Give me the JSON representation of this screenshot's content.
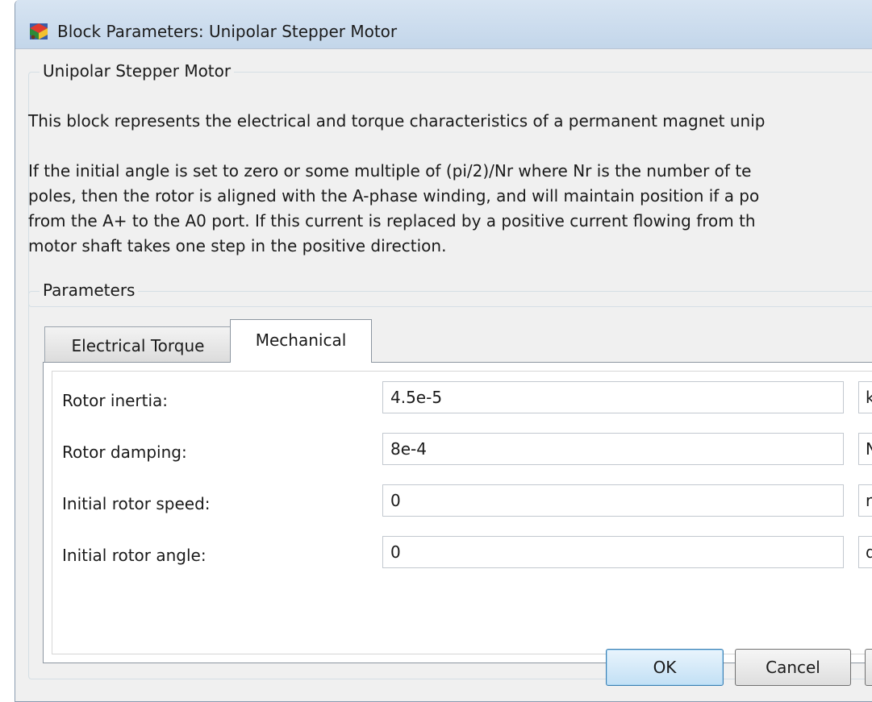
{
  "window": {
    "title": "Block Parameters: Unipolar Stepper Motor"
  },
  "description": {
    "group_title": "Unipolar Stepper Motor",
    "paragraph1": "This block represents the electrical and torque characteristics of a permanent magnet unip",
    "paragraph2_lines": [
      "If the initial angle is set to zero or some multiple of (pi/2)/Nr where Nr is the number of te",
      "poles, then the rotor is aligned with the A-phase winding, and will maintain position if a po",
      "from the A+ to the A0 port. If this current is replaced by a positive current flowing from th",
      "motor shaft takes one step in the positive direction."
    ]
  },
  "parameters": {
    "group_title": "Parameters",
    "tabs": [
      {
        "label": "Electrical Torque",
        "active": false
      },
      {
        "label": "Mechanical",
        "active": true
      }
    ],
    "fields": [
      {
        "label": "Rotor inertia:",
        "value": "4.5e-5",
        "unit": "k"
      },
      {
        "label": "Rotor damping:",
        "value": "8e-4",
        "unit": "N"
      },
      {
        "label": "Initial rotor speed:",
        "value": "0",
        "unit": "r"
      },
      {
        "label": "Initial rotor angle:",
        "value": "0",
        "unit": "d"
      }
    ]
  },
  "buttons": {
    "ok": "OK",
    "cancel": "Cancel"
  },
  "colors": {
    "titlebar": "#c9dbee",
    "dialog_background": "#f0f0f0",
    "default_button_border": "#3c7fb1"
  },
  "icons": {
    "title": "simulink-block-icon"
  }
}
